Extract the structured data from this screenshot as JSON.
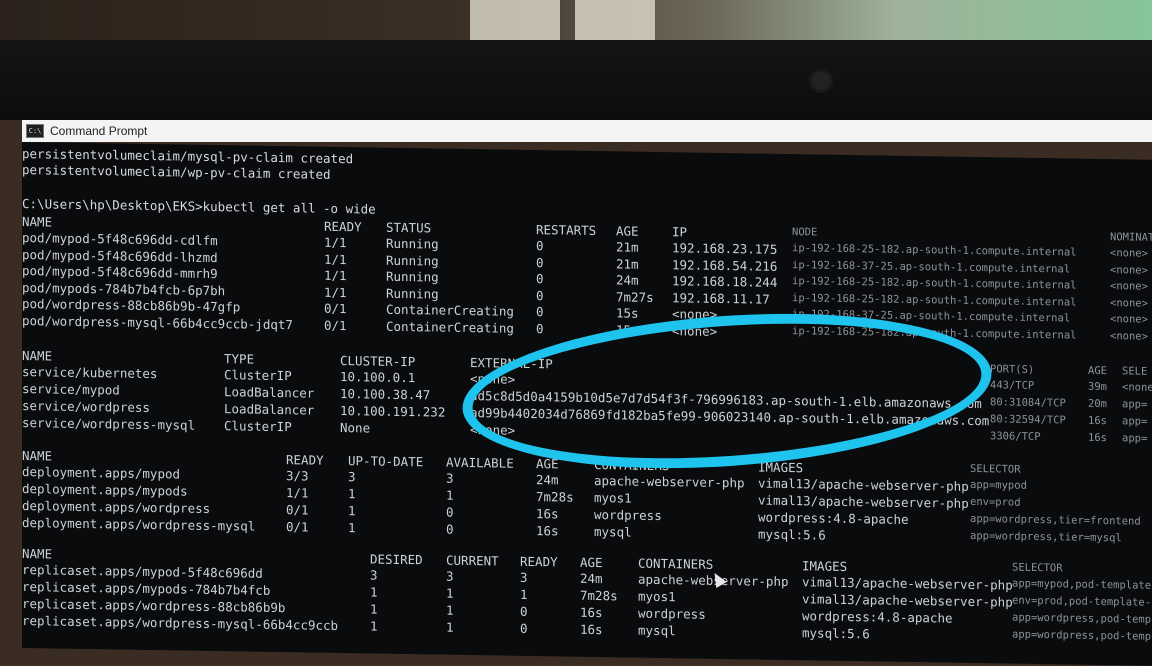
{
  "window": {
    "title": "Command Prompt"
  },
  "pre_lines": [
    "persistentvolumeclaim/mysql-pv-claim created",
    "persistentvolumeclaim/wp-pv-claim created",
    "",
    "C:\\Users\\hp\\Desktop\\EKS>kubectl get all -o wide"
  ],
  "pods": {
    "headers": [
      "NAME",
      "READY",
      "STATUS",
      "RESTARTS",
      "AGE",
      "IP",
      "NODE",
      "NOMINATED"
    ],
    "rows": [
      [
        "pod/mypod-5f48c696dd-cdlfm",
        "1/1",
        "Running",
        "0",
        "21m",
        "192.168.23.175",
        "ip-192-168-25-182.ap-south-1.compute.internal",
        "<none>"
      ],
      [
        "pod/mypod-5f48c696dd-lhzmd",
        "1/1",
        "Running",
        "0",
        "21m",
        "192.168.54.216",
        "ip-192-168-37-25.ap-south-1.compute.internal",
        "<none>"
      ],
      [
        "pod/mypod-5f48c696dd-mmrh9",
        "1/1",
        "Running",
        "0",
        "24m",
        "192.168.18.244",
        "ip-192-168-25-182.ap-south-1.compute.internal",
        "<none>"
      ],
      [
        "pod/mypods-784b7b4fcb-6p7bh",
        "1/1",
        "Running",
        "0",
        "7m27s",
        "192.168.11.17",
        "ip-192-168-25-182.ap-south-1.compute.internal",
        "<none>"
      ],
      [
        "pod/wordpress-88cb86b9b-47gfp",
        "0/1",
        "ContainerCreating",
        "0",
        "15s",
        "<none>",
        "ip-192-168-37-25.ap-south-1.compute.internal",
        "<none>"
      ],
      [
        "pod/wordpress-mysql-66b4cc9ccb-jdqt7",
        "0/1",
        "ContainerCreating",
        "0",
        "15s",
        "<none>",
        "ip-192-168-25-182.ap-south-1.compute.internal",
        "<none>"
      ]
    ]
  },
  "services": {
    "headers": [
      "NAME",
      "TYPE",
      "CLUSTER-IP",
      "EXTERNAL-IP",
      "PORT(S)",
      "AGE",
      "SELE"
    ],
    "rows": [
      [
        "service/kubernetes",
        "ClusterIP",
        "10.100.0.1",
        "<none>",
        "443/TCP",
        "39m",
        "<none>"
      ],
      [
        "service/mypod",
        "LoadBalancer",
        "10.100.38.47",
        "ad5c8d5d0a4159b10d5e7d7d54f3f-796996183.ap-south-1.elb.amazonaws.com",
        "80:31084/TCP",
        "20m",
        "app="
      ],
      [
        "service/wordpress",
        "LoadBalancer",
        "10.100.191.232",
        "ad99b4402034d76869fd182ba5fe99-906023140.ap-south-1.elb.amazonaws.com",
        "80:32594/TCP",
        "16s",
        "app="
      ],
      [
        "service/wordpress-mysql",
        "ClusterIP",
        "None",
        "<none>",
        "3306/TCP",
        "16s",
        "app="
      ]
    ]
  },
  "deployments": {
    "headers": [
      "NAME",
      "READY",
      "UP-TO-DATE",
      "AVAILABLE",
      "AGE",
      "CONTAINERS",
      "IMAGES",
      "SELECTOR"
    ],
    "rows": [
      [
        "deployment.apps/mypod",
        "3/3",
        "3",
        "3",
        "24m",
        "apache-webserver-php",
        "vimal13/apache-webserver-php",
        "app=mypod"
      ],
      [
        "deployment.apps/mypods",
        "1/1",
        "1",
        "1",
        "7m28s",
        "myos1",
        "vimal13/apache-webserver-php",
        "env=prod"
      ],
      [
        "deployment.apps/wordpress",
        "0/1",
        "1",
        "0",
        "16s",
        "wordpress",
        "wordpress:4.8-apache",
        "app=wordpress,tier=frontend"
      ],
      [
        "deployment.apps/wordpress-mysql",
        "0/1",
        "1",
        "0",
        "16s",
        "mysql",
        "mysql:5.6",
        "app=wordpress,tier=mysql"
      ]
    ]
  },
  "replicasets": {
    "headers": [
      "NAME",
      "DESIRED",
      "CURRENT",
      "READY",
      "AGE",
      "CONTAINERS",
      "IMAGES",
      "SELECTOR"
    ],
    "rows": [
      [
        "replicaset.apps/mypod-5f48c696dd",
        "3",
        "3",
        "3",
        "24m",
        "apache-webserver-php",
        "vimal13/apache-webserver-php",
        "app=mypod,pod-template-"
      ],
      [
        "replicaset.apps/mypods-784b7b4fcb",
        "1",
        "1",
        "1",
        "7m28s",
        "myos1",
        "vimal13/apache-webserver-php",
        "env=prod,pod-template-h"
      ],
      [
        "replicaset.apps/wordpress-88cb86b9b",
        "1",
        "1",
        "0",
        "16s",
        "wordpress",
        "wordpress:4.8-apache",
        "app=wordpress,pod-templ"
      ],
      [
        "replicaset.apps/wordpress-mysql-66b4cc9ccb",
        "1",
        "1",
        "0",
        "16s",
        "mysql",
        "mysql:5.6",
        "app=wordpress,pod-templ"
      ]
    ]
  },
  "colors": {
    "annotation_circle": "#1ec3ee",
    "terminal_bg": "#0a0b0d",
    "terminal_text": "#d6d9de"
  }
}
